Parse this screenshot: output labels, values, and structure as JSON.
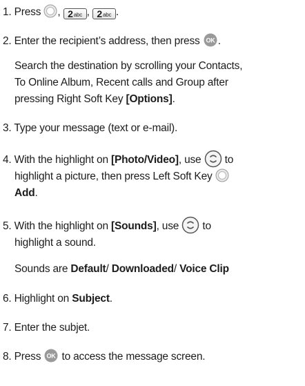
{
  "steps": {
    "s1": {
      "prefix": "1. Press ",
      "sep1": ", ",
      "sep2": ", ",
      "end": ".",
      "key_num": "2",
      "key_letters": "abc"
    },
    "s2": {
      "text": "2. Enter the recipient’s address, then press ",
      "end": "."
    },
    "s2_note": {
      "line1": "Search the destination by scrolling your Contacts,",
      "line2": "To Online Album, Recent calls and Group after",
      "line3_pre": "pressing Right Soft Key ",
      "line3_bold": "[Options]",
      "line3_end": "."
    },
    "s3": {
      "text": "3. Type your message (text or e-mail)."
    },
    "s4": {
      "pre": "4. With the highlight on ",
      "bold": "[Photo/Video]",
      "mid": ", use ",
      "post": " to",
      "line2": "highlight a picture, then press Left Soft Key ",
      "line3_bold": "Add",
      "line3_end": "."
    },
    "s5": {
      "pre": "5. With the highlight on ",
      "bold": "[Sounds]",
      "mid": ", use ",
      "post": " to",
      "line2": "highlight a sound."
    },
    "s5_note": {
      "pre": "Sounds are ",
      "b1": "Default",
      "sep1": "/ ",
      "b2": "Downloaded",
      "sep2": "/ ",
      "b3": "Voice Clip"
    },
    "s6": {
      "pre": "6. Highlight on ",
      "bold": "Subject",
      "end": "."
    },
    "s7": {
      "text": "7. Enter the subjet."
    },
    "s8": {
      "pre": "8. Press ",
      "post": " to access the message screen."
    }
  },
  "icons": {
    "menu_key": "round-soft-key-icon",
    "key2": "key-2abc-icon",
    "ok_key": "ok-key-icon",
    "nav_key": "up-down-navigation-key-icon"
  }
}
